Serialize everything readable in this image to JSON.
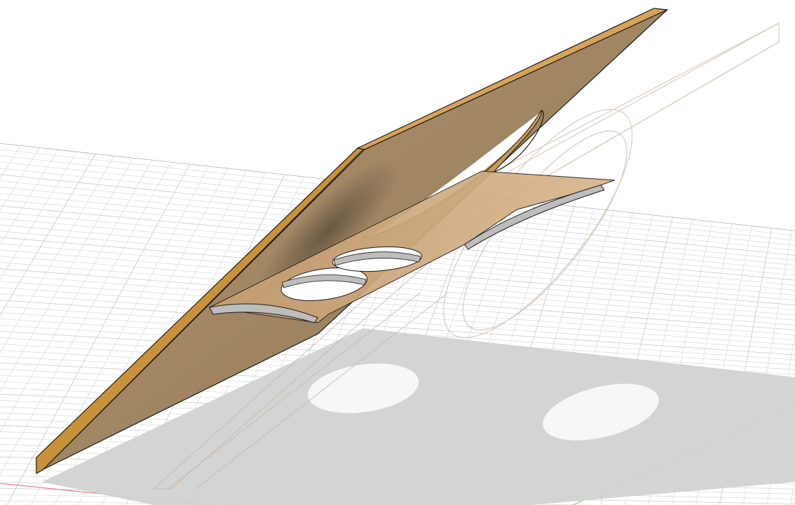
{
  "viewport": {
    "background_color": "#ffffff",
    "grid_color": "#d9dde3",
    "grid_major_color": "#c5cad2",
    "x_axis_color": "#e06a6a",
    "y_axis_color": "#6ad66a"
  },
  "model": {
    "panel_face_color": "#a58a66",
    "panel_edge_color": "#c9913a",
    "panel_outline_color": "#1e1a14",
    "shelf_color": "#cba57b",
    "cutout_wall_color": "#bdbdbd",
    "ghost_color": "#d8c8b8",
    "shadow_color": "#cfcfcf"
  }
}
